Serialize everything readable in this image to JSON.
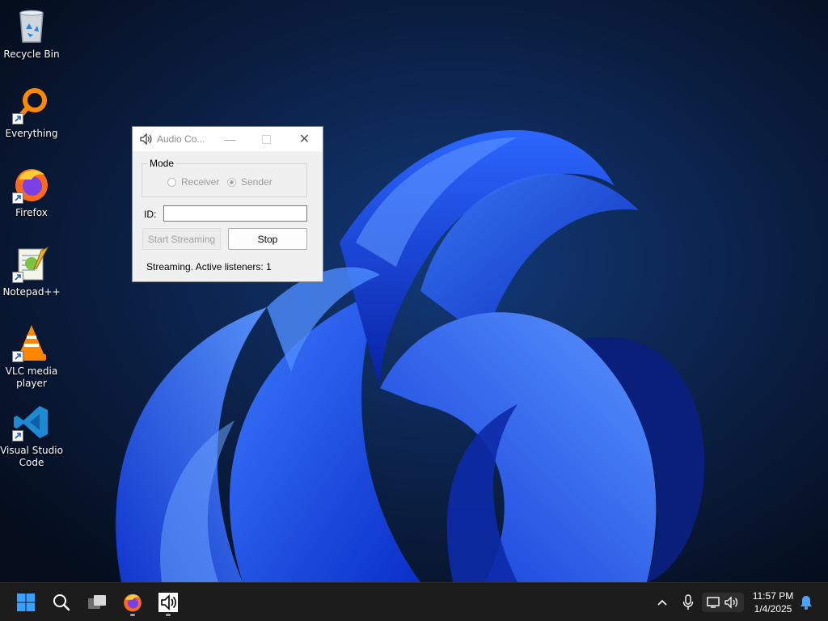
{
  "desktop": {
    "icons": [
      {
        "label": "Recycle Bin",
        "icon": "recycle-bin-icon"
      },
      {
        "label": "Everything",
        "icon": "everything-search-icon"
      },
      {
        "label": "Firefox",
        "icon": "firefox-icon"
      },
      {
        "label": "Notepad++",
        "icon": "notepad-plus-plus-icon"
      },
      {
        "label": "VLC media player",
        "icon": "vlc-icon"
      },
      {
        "label": "Visual Studio Code",
        "icon": "vscode-icon"
      }
    ]
  },
  "window": {
    "title": "Audio Co...",
    "mode_label": "Mode",
    "radio_receiver": "Receiver",
    "radio_sender": "Sender",
    "selected_mode": "Sender",
    "id_label": "ID:",
    "id_value": "",
    "start_button": "Start Streaming",
    "stop_button": "Stop",
    "status": "Streaming. Active listeners: 1"
  },
  "taskbar": {
    "pinned": [
      "start-icon",
      "search-icon",
      "task-view-icon",
      "firefox-icon",
      "audio-app-icon"
    ],
    "tray": [
      "chevron-up-icon",
      "microphone-icon",
      "network-icon",
      "speaker-icon",
      "notification-bell-icon"
    ],
    "time": "11:57 PM",
    "date": "1/4/2025"
  },
  "colors": {
    "accent": "#1e5bff",
    "taskbar_bg": "#1c1c1c",
    "desktop_bg": "#071226"
  }
}
